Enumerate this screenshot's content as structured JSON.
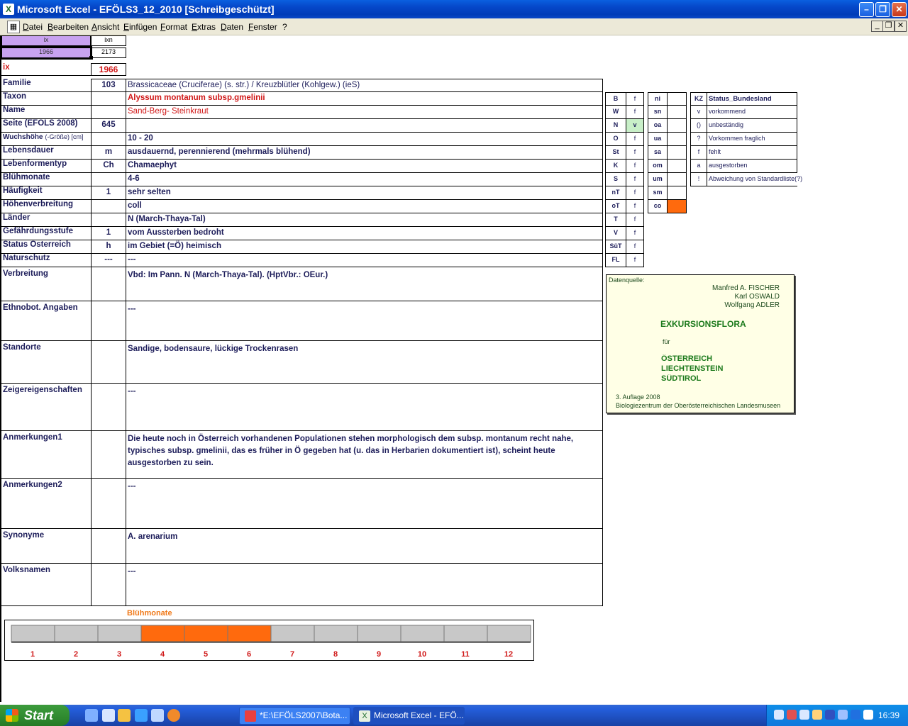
{
  "window": {
    "title": "Microsoft Excel - EFÖLS3_12_2010  [Schreibgeschützt]"
  },
  "menu": [
    "Datei",
    "Bearbeiten",
    "Ansicht",
    "Einfügen",
    "Format",
    "Extras",
    "Daten",
    "Fenster",
    "?"
  ],
  "topcells": {
    "ix_header": "ix",
    "ixn_header": "ixn",
    "ix_value": "1966",
    "ixn_value": "2173",
    "ix_label": "ix",
    "ix_big": "1966"
  },
  "fields": [
    {
      "label": "Familie",
      "code": "103",
      "value": "Brassicaceae (Cruciferae) (s. str.)  /  Kreuzblütler (Kohlgew.) (ieS)"
    },
    {
      "label": "Taxon",
      "code": "",
      "value": "Alyssum montanum subsp.gmelinii"
    },
    {
      "label": "Name",
      "code": "",
      "value": "Sand-Berg- Steinkraut"
    },
    {
      "label": "Seite (EFÖLS 2008)",
      "code": "645",
      "value": ""
    },
    {
      "label": "Wuchshöhe",
      "label_small": "(-Größe) [cm]",
      "code": "",
      "value": " 10 - 20"
    },
    {
      "label": "Lebensdauer",
      "code": "m",
      "value": "ausdauernd, perennierend (mehrmals blühend)"
    },
    {
      "label": "Lebenformentyp",
      "code": "Ch",
      "value": "Chamaephyt"
    },
    {
      "label": "Blühmonate",
      "code": "",
      "value": " 4-6"
    },
    {
      "label": "Häufigkeit",
      "code": "1",
      "value": "sehr selten"
    },
    {
      "label": "Höhenverbreitung",
      "code": "",
      "value": "coll"
    },
    {
      "label": "Länder",
      "code": "",
      "value": "N (March-Thaya-Tal)"
    },
    {
      "label": "Gefährdungsstufe",
      "code": "1",
      "value": "vom Aussterben bedroht"
    },
    {
      "label": "Status Österreich",
      "code": "h",
      "value": "im Gebiet (=Ö) heimisch"
    },
    {
      "label": "Naturschutz",
      "code": "---",
      "value": " ---"
    }
  ],
  "bigfields": [
    {
      "label": "Verbreitung",
      "value": "Vbd: Im Pann. N (March-Thaya-Tal). (HptVbr.: OEur.)"
    },
    {
      "label": "Ethnobot. Angaben",
      "value": "---"
    },
    {
      "label": "Standorte",
      "value": "Sandige, bodensaure, lückige Trockenrasen"
    },
    {
      "label": "Zeigereigenschaften",
      "value": "---"
    },
    {
      "label": "Anmerkungen1",
      "value": "Die heute noch in Österreich vorhandenen Populationen stehen morphologisch dem subsp. montanum recht nahe,\ntypisches subsp. gmelinii, das es früher in Ö gegeben hat (u. das in Herbarien dokumentiert ist), scheint heute\nausgestorben zu sein."
    },
    {
      "label": "Anmerkungen2",
      "value": "---"
    },
    {
      "label": "Synonyme",
      "value": "A. arenarium"
    },
    {
      "label": "Volksnamen",
      "value": "---"
    }
  ],
  "bundesland": [
    {
      "code": "B",
      "status": "f"
    },
    {
      "code": "W",
      "status": "f"
    },
    {
      "code": "N",
      "status": "v"
    },
    {
      "code": "O",
      "status": "f"
    },
    {
      "code": "St",
      "status": "f"
    },
    {
      "code": "K",
      "status": "f"
    },
    {
      "code": "S",
      "status": "f"
    },
    {
      "code": "nT",
      "status": "f"
    },
    {
      "code": "oT",
      "status": "f"
    },
    {
      "code": "T",
      "status": "f"
    },
    {
      "code": "V",
      "status": "f"
    },
    {
      "code": "SüT",
      "status": "f"
    },
    {
      "code": "FL",
      "status": "f"
    }
  ],
  "regions": [
    "ni",
    "sn",
    "oa",
    "ua",
    "sa",
    "om",
    "um",
    "sm",
    "co"
  ],
  "legend": {
    "header_kz": "KZ",
    "header_status": "Status_Bundesland",
    "rows": [
      {
        "kz": "v",
        "text": "vorkommend"
      },
      {
        "kz": "()",
        "text": "unbeständig"
      },
      {
        "kz": "?",
        "text": "Vorkommen fraglich"
      },
      {
        "kz": "f",
        "text": "fehlt"
      },
      {
        "kz": "a",
        "text": "ausgestorben"
      },
      {
        "kz": "!",
        "text": "Abweichung von Standardliste(?)"
      }
    ]
  },
  "source": {
    "label": "Datenquelle:",
    "authors": [
      "Manfred A. FISCHER",
      "Karl OSWALD",
      "Wolfgang ADLER"
    ],
    "title": "EXKURSIONSFLORA",
    "fuer": "für",
    "countries": [
      "ÖSTERREICH",
      "LIECHTENSTEIN",
      "SÜDTIROL"
    ],
    "edition": "3. Auflage 2008",
    "publisher": "Biologiezentrum der Oberösterreichischen Landesmuseen"
  },
  "chart_data": {
    "type": "bar",
    "title": "Blühmonate",
    "categories": [
      "1",
      "2",
      "3",
      "4",
      "5",
      "6",
      "7",
      "8",
      "9",
      "10",
      "11",
      "12"
    ],
    "values": [
      0,
      0,
      0,
      1,
      1,
      1,
      0,
      0,
      0,
      0,
      0,
      0
    ],
    "colors": {
      "on": "#ff6a0d",
      "off": "#c8c8c8"
    }
  },
  "taskbar": {
    "start": "Start",
    "items": [
      "*E:\\EFÖLS2007\\Bota...",
      "Microsoft Excel - EFÖ..."
    ],
    "clock": "16:39"
  },
  "colors": {
    "purple": "#c8a2f0",
    "orange": "#ff6a0d",
    "green": "#c8efc8",
    "title_red": "#d01818",
    "navy": "#1d1d5a"
  }
}
